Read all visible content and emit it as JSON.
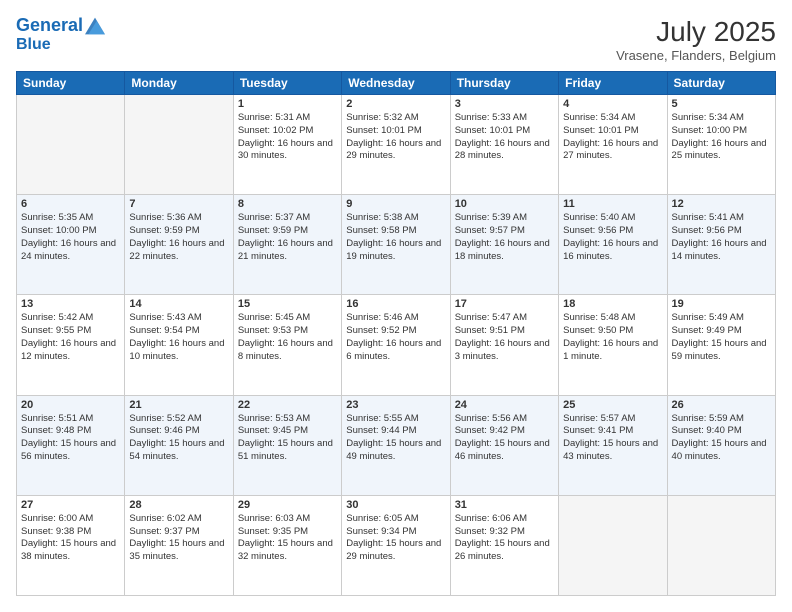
{
  "header": {
    "logo_line1": "General",
    "logo_line2": "Blue",
    "month": "July 2025",
    "location": "Vrasene, Flanders, Belgium"
  },
  "days_of_week": [
    "Sunday",
    "Monday",
    "Tuesday",
    "Wednesday",
    "Thursday",
    "Friday",
    "Saturday"
  ],
  "weeks": [
    [
      {
        "day": "",
        "sunrise": "",
        "sunset": "",
        "daylight": ""
      },
      {
        "day": "",
        "sunrise": "",
        "sunset": "",
        "daylight": ""
      },
      {
        "day": "1",
        "sunrise": "Sunrise: 5:31 AM",
        "sunset": "Sunset: 10:02 PM",
        "daylight": "Daylight: 16 hours and 30 minutes."
      },
      {
        "day": "2",
        "sunrise": "Sunrise: 5:32 AM",
        "sunset": "Sunset: 10:01 PM",
        "daylight": "Daylight: 16 hours and 29 minutes."
      },
      {
        "day": "3",
        "sunrise": "Sunrise: 5:33 AM",
        "sunset": "Sunset: 10:01 PM",
        "daylight": "Daylight: 16 hours and 28 minutes."
      },
      {
        "day": "4",
        "sunrise": "Sunrise: 5:34 AM",
        "sunset": "Sunset: 10:01 PM",
        "daylight": "Daylight: 16 hours and 27 minutes."
      },
      {
        "day": "5",
        "sunrise": "Sunrise: 5:34 AM",
        "sunset": "Sunset: 10:00 PM",
        "daylight": "Daylight: 16 hours and 25 minutes."
      }
    ],
    [
      {
        "day": "6",
        "sunrise": "Sunrise: 5:35 AM",
        "sunset": "Sunset: 10:00 PM",
        "daylight": "Daylight: 16 hours and 24 minutes."
      },
      {
        "day": "7",
        "sunrise": "Sunrise: 5:36 AM",
        "sunset": "Sunset: 9:59 PM",
        "daylight": "Daylight: 16 hours and 22 minutes."
      },
      {
        "day": "8",
        "sunrise": "Sunrise: 5:37 AM",
        "sunset": "Sunset: 9:59 PM",
        "daylight": "Daylight: 16 hours and 21 minutes."
      },
      {
        "day": "9",
        "sunrise": "Sunrise: 5:38 AM",
        "sunset": "Sunset: 9:58 PM",
        "daylight": "Daylight: 16 hours and 19 minutes."
      },
      {
        "day": "10",
        "sunrise": "Sunrise: 5:39 AM",
        "sunset": "Sunset: 9:57 PM",
        "daylight": "Daylight: 16 hours and 18 minutes."
      },
      {
        "day": "11",
        "sunrise": "Sunrise: 5:40 AM",
        "sunset": "Sunset: 9:56 PM",
        "daylight": "Daylight: 16 hours and 16 minutes."
      },
      {
        "day": "12",
        "sunrise": "Sunrise: 5:41 AM",
        "sunset": "Sunset: 9:56 PM",
        "daylight": "Daylight: 16 hours and 14 minutes."
      }
    ],
    [
      {
        "day": "13",
        "sunrise": "Sunrise: 5:42 AM",
        "sunset": "Sunset: 9:55 PM",
        "daylight": "Daylight: 16 hours and 12 minutes."
      },
      {
        "day": "14",
        "sunrise": "Sunrise: 5:43 AM",
        "sunset": "Sunset: 9:54 PM",
        "daylight": "Daylight: 16 hours and 10 minutes."
      },
      {
        "day": "15",
        "sunrise": "Sunrise: 5:45 AM",
        "sunset": "Sunset: 9:53 PM",
        "daylight": "Daylight: 16 hours and 8 minutes."
      },
      {
        "day": "16",
        "sunrise": "Sunrise: 5:46 AM",
        "sunset": "Sunset: 9:52 PM",
        "daylight": "Daylight: 16 hours and 6 minutes."
      },
      {
        "day": "17",
        "sunrise": "Sunrise: 5:47 AM",
        "sunset": "Sunset: 9:51 PM",
        "daylight": "Daylight: 16 hours and 3 minutes."
      },
      {
        "day": "18",
        "sunrise": "Sunrise: 5:48 AM",
        "sunset": "Sunset: 9:50 PM",
        "daylight": "Daylight: 16 hours and 1 minute."
      },
      {
        "day": "19",
        "sunrise": "Sunrise: 5:49 AM",
        "sunset": "Sunset: 9:49 PM",
        "daylight": "Daylight: 15 hours and 59 minutes."
      }
    ],
    [
      {
        "day": "20",
        "sunrise": "Sunrise: 5:51 AM",
        "sunset": "Sunset: 9:48 PM",
        "daylight": "Daylight: 15 hours and 56 minutes."
      },
      {
        "day": "21",
        "sunrise": "Sunrise: 5:52 AM",
        "sunset": "Sunset: 9:46 PM",
        "daylight": "Daylight: 15 hours and 54 minutes."
      },
      {
        "day": "22",
        "sunrise": "Sunrise: 5:53 AM",
        "sunset": "Sunset: 9:45 PM",
        "daylight": "Daylight: 15 hours and 51 minutes."
      },
      {
        "day": "23",
        "sunrise": "Sunrise: 5:55 AM",
        "sunset": "Sunset: 9:44 PM",
        "daylight": "Daylight: 15 hours and 49 minutes."
      },
      {
        "day": "24",
        "sunrise": "Sunrise: 5:56 AM",
        "sunset": "Sunset: 9:42 PM",
        "daylight": "Daylight: 15 hours and 46 minutes."
      },
      {
        "day": "25",
        "sunrise": "Sunrise: 5:57 AM",
        "sunset": "Sunset: 9:41 PM",
        "daylight": "Daylight: 15 hours and 43 minutes."
      },
      {
        "day": "26",
        "sunrise": "Sunrise: 5:59 AM",
        "sunset": "Sunset: 9:40 PM",
        "daylight": "Daylight: 15 hours and 40 minutes."
      }
    ],
    [
      {
        "day": "27",
        "sunrise": "Sunrise: 6:00 AM",
        "sunset": "Sunset: 9:38 PM",
        "daylight": "Daylight: 15 hours and 38 minutes."
      },
      {
        "day": "28",
        "sunrise": "Sunrise: 6:02 AM",
        "sunset": "Sunset: 9:37 PM",
        "daylight": "Daylight: 15 hours and 35 minutes."
      },
      {
        "day": "29",
        "sunrise": "Sunrise: 6:03 AM",
        "sunset": "Sunset: 9:35 PM",
        "daylight": "Daylight: 15 hours and 32 minutes."
      },
      {
        "day": "30",
        "sunrise": "Sunrise: 6:05 AM",
        "sunset": "Sunset: 9:34 PM",
        "daylight": "Daylight: 15 hours and 29 minutes."
      },
      {
        "day": "31",
        "sunrise": "Sunrise: 6:06 AM",
        "sunset": "Sunset: 9:32 PM",
        "daylight": "Daylight: 15 hours and 26 minutes."
      },
      {
        "day": "",
        "sunrise": "",
        "sunset": "",
        "daylight": ""
      },
      {
        "day": "",
        "sunrise": "",
        "sunset": "",
        "daylight": ""
      }
    ]
  ]
}
